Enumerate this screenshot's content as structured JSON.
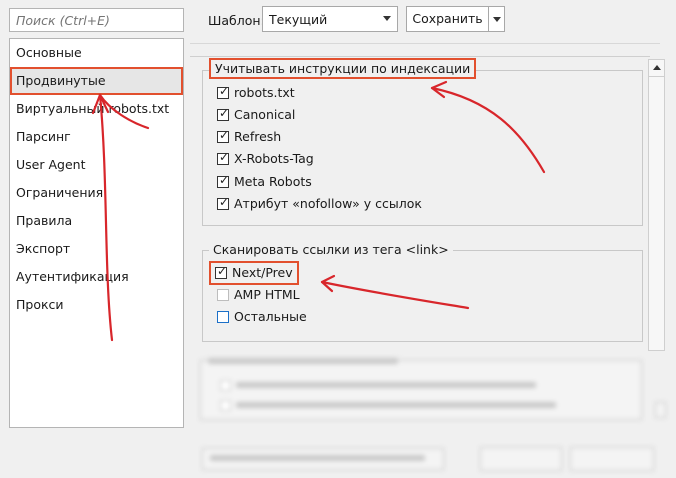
{
  "search": {
    "placeholder": "Поиск (Ctrl+E)"
  },
  "sidebar": {
    "items": [
      {
        "label": "Основные"
      },
      {
        "label": "Продвинутые",
        "selected": true
      },
      {
        "label": "Виртуальный robots.txt"
      },
      {
        "label": "Парсинг"
      },
      {
        "label": "User Agent"
      },
      {
        "label": "Ограничения"
      },
      {
        "label": "Правила"
      },
      {
        "label": "Экспорт"
      },
      {
        "label": "Аутентификация"
      },
      {
        "label": "Прокси"
      }
    ]
  },
  "toolbar": {
    "template_label": "Шаблон:",
    "template_value": "Текущий",
    "save_label": "Сохранить"
  },
  "indexing_group": {
    "title": "Учитывать инструкции по индексации",
    "items": [
      {
        "label": "robots.txt",
        "checked": true
      },
      {
        "label": "Canonical",
        "checked": true
      },
      {
        "label": "Refresh",
        "checked": true
      },
      {
        "label": "X-Robots-Tag",
        "checked": true
      },
      {
        "label": "Meta Robots",
        "checked": true
      },
      {
        "label": "Атрибут «nofollow» у ссылок",
        "checked": true
      }
    ]
  },
  "link_group": {
    "title": "Сканировать ссылки из тега <link>",
    "items": [
      {
        "label": "Next/Prev",
        "checked": true
      },
      {
        "label": "AMP HTML",
        "checked": false
      },
      {
        "label": "Остальные",
        "checked": false
      }
    ]
  },
  "colors": {
    "highlight": "#e2502e",
    "arrow": "#d8262b",
    "focus_box": "#1b70c8"
  }
}
